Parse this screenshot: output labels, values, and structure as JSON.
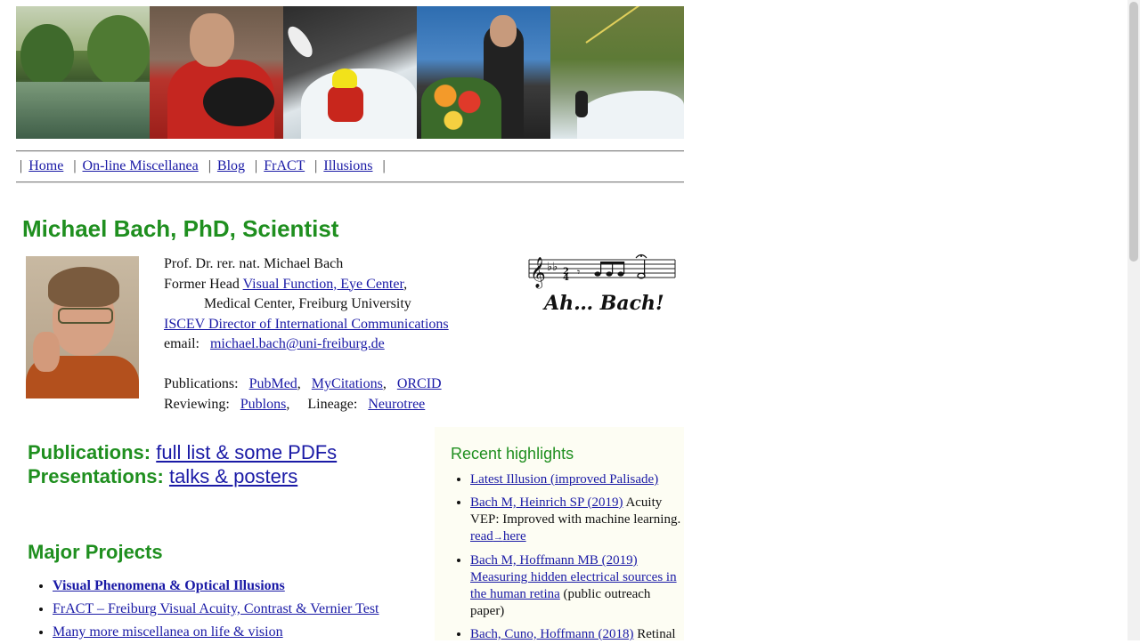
{
  "nav": {
    "items": [
      {
        "label": "Home"
      },
      {
        "label": "On-line Miscellanea"
      },
      {
        "label": "Blog"
      },
      {
        "label": "FrACT"
      },
      {
        "label": "Illusions"
      }
    ],
    "separator": "|"
  },
  "title": "Michael Bach, PhD, Scientist",
  "info": {
    "name": "Prof. Dr. rer. nat. Michael Bach",
    "former_head_prefix": "Former Head",
    "former_head_link": "Visual Function, Eye Center",
    "former_head_suffix": ",",
    "affiliation": "Medical Center, Freiburg University",
    "iscev_link": "ISCEV Director of International Communications",
    "email_label": "email:",
    "email_link": "michael.bach@uni-freiburg.de",
    "publications_label": "Publications:",
    "pubmed_link": "PubMed",
    "mycitations_link": "MyCitations",
    "orcid_link": "ORCID",
    "comma": ",",
    "reviewing_label": "Reviewing:",
    "publons_link": "Publons",
    "lineage_label": "Lineage:",
    "neurotree_link": "Neurotree"
  },
  "logo": {
    "text": "Ah… Bach!"
  },
  "publications": {
    "label": "Publications:",
    "link": "full list & some PDFs"
  },
  "presentations": {
    "label": "Presentations:",
    "link": "talks & posters"
  },
  "major_projects": {
    "title": "Major Projects",
    "items": [
      {
        "label": "Visual Phenomena & Optical Illusions"
      },
      {
        "label": "FrACT – Freiburg Visual Acuity, Contrast & Vernier Test"
      },
      {
        "label": "Many more miscellanea on life & vision"
      }
    ]
  },
  "highlights": {
    "title": "Recent highlights",
    "items": [
      {
        "link": "Latest Illusion (improved Palisade)"
      },
      {
        "link": "Bach M, Heinrich SP (2019)",
        "text": " Acuity VEP: Improved with machine learning.",
        "read_link_a": "read",
        "arrow": "→",
        "read_link_b": "here"
      },
      {
        "link": "Bach M, Hoffmann MB (2019) Measuring hidden electrical sources in the human retina",
        "text": " (public outreach paper)"
      },
      {
        "link": "Bach, Cuno, Hoffmann (2018)",
        "text": " Retinal"
      }
    ]
  },
  "colors": {
    "heading_green": "#1f8f1f",
    "link_blue": "#1a1aa6",
    "highlights_bg": "#fdfdf3"
  }
}
